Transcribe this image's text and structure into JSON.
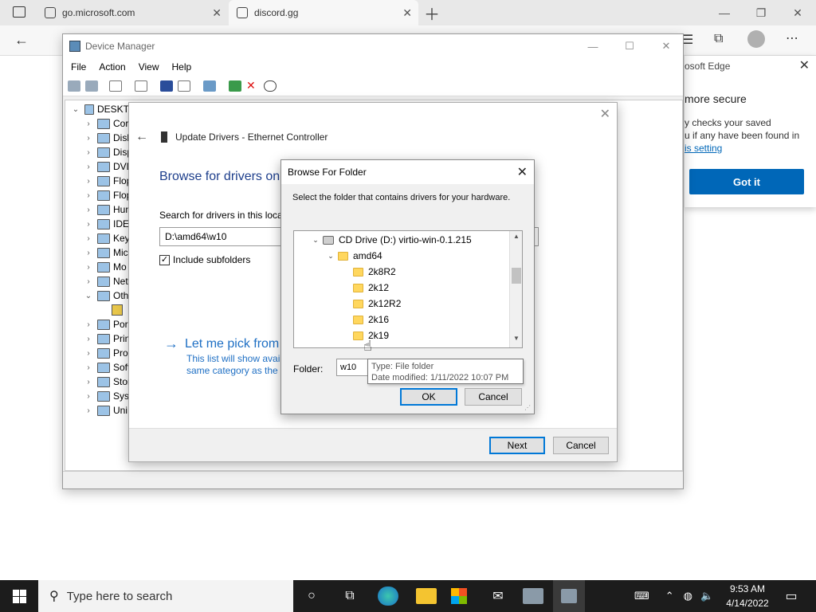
{
  "browser": {
    "tabs": [
      {
        "label": "go.microsoft.com"
      },
      {
        "label": "discord.gg"
      }
    ],
    "new_tab_icon": "plus-icon"
  },
  "edge_popup": {
    "header": "osoft Edge",
    "title": "more secure",
    "body_line1": "y checks your saved",
    "body_line2": "u if any have been found in",
    "link": "is setting",
    "button": "Got it"
  },
  "device_manager": {
    "title": "Device Manager",
    "menu": [
      "File",
      "Action",
      "View",
      "Help"
    ],
    "tree": {
      "root": "DESKTO",
      "items": [
        {
          "label": "Cor",
          "icon": "monitor-icon"
        },
        {
          "label": "Disk",
          "icon": "disk-icon"
        },
        {
          "label": "Disp",
          "icon": "display-icon"
        },
        {
          "label": "DVD",
          "icon": "dvd-icon"
        },
        {
          "label": "Flop",
          "icon": "floppy-icon"
        },
        {
          "label": "Flop",
          "icon": "floppy-icon"
        },
        {
          "label": "Hun",
          "icon": "hid-icon"
        },
        {
          "label": "IDE",
          "icon": "ide-icon"
        },
        {
          "label": "Key",
          "icon": "keyboard-icon"
        },
        {
          "label": "Mic",
          "icon": "mouse-icon"
        },
        {
          "label": "Mo",
          "icon": "monitor-icon"
        },
        {
          "label": "Net",
          "icon": "network-icon"
        },
        {
          "label": "Oth",
          "icon": "other-devices-icon"
        },
        {
          "label": "Por",
          "icon": "port-icon"
        },
        {
          "label": "Prin",
          "icon": "printer-icon"
        },
        {
          "label": "Pro",
          "icon": "processor-icon"
        },
        {
          "label": "Soft",
          "icon": "software-icon"
        },
        {
          "label": "Stor",
          "icon": "storage-icon"
        },
        {
          "label": "Syst",
          "icon": "system-icon"
        },
        {
          "label": "Uni",
          "icon": "usb-icon"
        }
      ]
    }
  },
  "wizard": {
    "header": "Update Drivers - Ethernet Controller",
    "title": "Browse for drivers on",
    "search_label": "Search for drivers in this locat",
    "path_value": "D:\\amd64\\w10",
    "include_subfolders": "Include subfolders",
    "pick_link": "Let me pick from",
    "pick_desc_line1": "This list will show avail",
    "pick_desc_line2": "same category as the d",
    "next": "Next",
    "cancel": "Cancel"
  },
  "browse_folder": {
    "title": "Browse For Folder",
    "description": "Select the folder that contains drivers for your hardware.",
    "tree": [
      {
        "label": "CD Drive (D:) virtio-win-0.1.215",
        "level": 0,
        "type": "drive",
        "expanded": true
      },
      {
        "label": "amd64",
        "level": 1,
        "type": "folder",
        "expanded": true
      },
      {
        "label": "2k8R2",
        "level": 2,
        "type": "folder"
      },
      {
        "label": "2k12",
        "level": 2,
        "type": "folder"
      },
      {
        "label": "2k12R2",
        "level": 2,
        "type": "folder"
      },
      {
        "label": "2k16",
        "level": 2,
        "type": "folder"
      },
      {
        "label": "2k19",
        "level": 2,
        "type": "folder"
      }
    ],
    "folder_label": "Folder:",
    "folder_value": "w10",
    "tooltip_line1": "Type: File folder",
    "tooltip_line2": "Date modified: 1/11/2022 10:07 PM",
    "ok": "OK",
    "cancel": "Cancel"
  },
  "taskbar": {
    "search_placeholder": "Type here to search",
    "time": "9:53 AM",
    "date": "4/14/2022"
  }
}
